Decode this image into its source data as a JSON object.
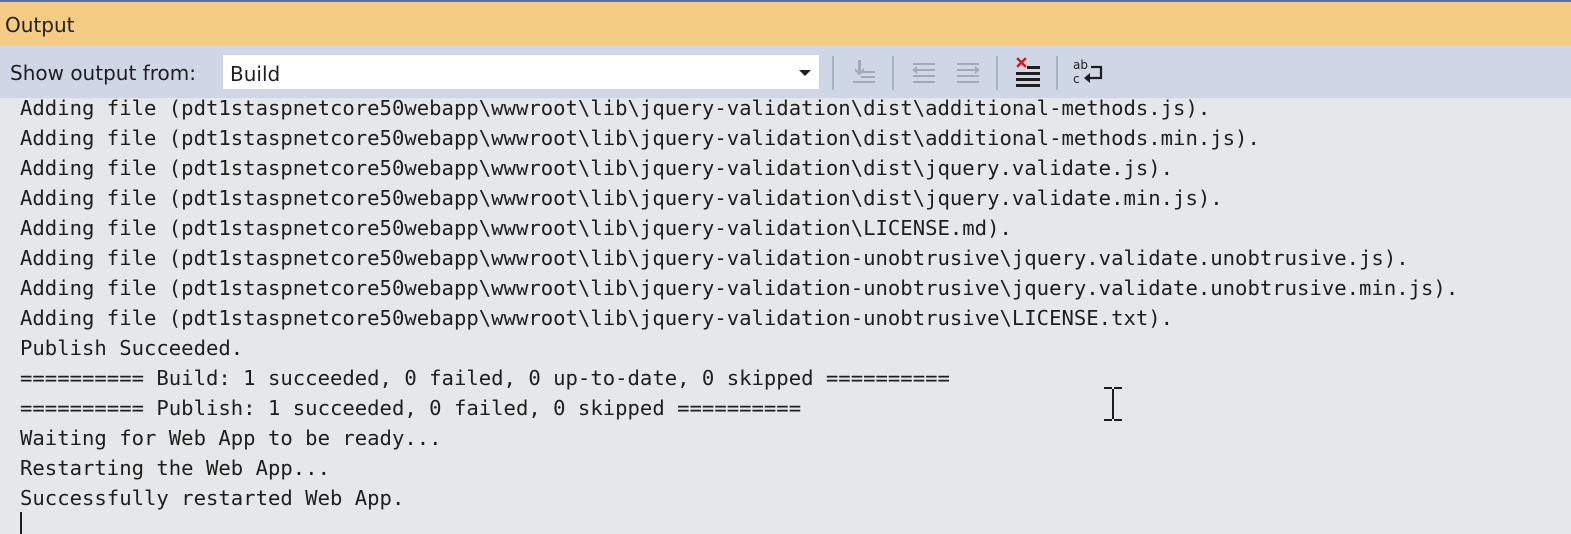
{
  "panel": {
    "title": "Output"
  },
  "toolbar": {
    "show_output_label": "Show output from:",
    "source_selected": "Build",
    "buttons": [
      {
        "name": "find-message-in-code-icon",
        "enabled": false
      },
      {
        "name": "go-to-previous-message-icon",
        "enabled": false
      },
      {
        "name": "go-to-next-message-icon",
        "enabled": false
      },
      {
        "name": "clear-all-icon",
        "enabled": true
      },
      {
        "name": "toggle-word-wrap-icon",
        "enabled": true
      }
    ]
  },
  "log": {
    "lines": [
      "Adding file (pdt1staspnetcore50webapp\\wwwroot\\lib\\jquery-validation\\dist\\additional-methods.js).",
      "Adding file (pdt1staspnetcore50webapp\\wwwroot\\lib\\jquery-validation\\dist\\additional-methods.min.js).",
      "Adding file (pdt1staspnetcore50webapp\\wwwroot\\lib\\jquery-validation\\dist\\jquery.validate.js).",
      "Adding file (pdt1staspnetcore50webapp\\wwwroot\\lib\\jquery-validation\\dist\\jquery.validate.min.js).",
      "Adding file (pdt1staspnetcore50webapp\\wwwroot\\lib\\jquery-validation\\LICENSE.md).",
      "Adding file (pdt1staspnetcore50webapp\\wwwroot\\lib\\jquery-validation-unobtrusive\\jquery.validate.unobtrusive.js).",
      "Adding file (pdt1staspnetcore50webapp\\wwwroot\\lib\\jquery-validation-unobtrusive\\jquery.validate.unobtrusive.min.js).",
      "Adding file (pdt1staspnetcore50webapp\\wwwroot\\lib\\jquery-validation-unobtrusive\\LICENSE.txt).",
      "Publish Succeeded.",
      "========== Build: 1 succeeded, 0 failed, 0 up-to-date, 0 skipped ==========",
      "========== Publish: 1 succeeded, 0 failed, 0 skipped ==========",
      "Waiting for Web App to be ready...",
      "Restarting the Web App...",
      "Successfully restarted Web App."
    ]
  },
  "colors": {
    "title_bar": "#f5cc84",
    "toolbar": "#cfd6e5",
    "output_bg": "#e6e7e8",
    "clear_icon_accent": "#c81e1e"
  }
}
